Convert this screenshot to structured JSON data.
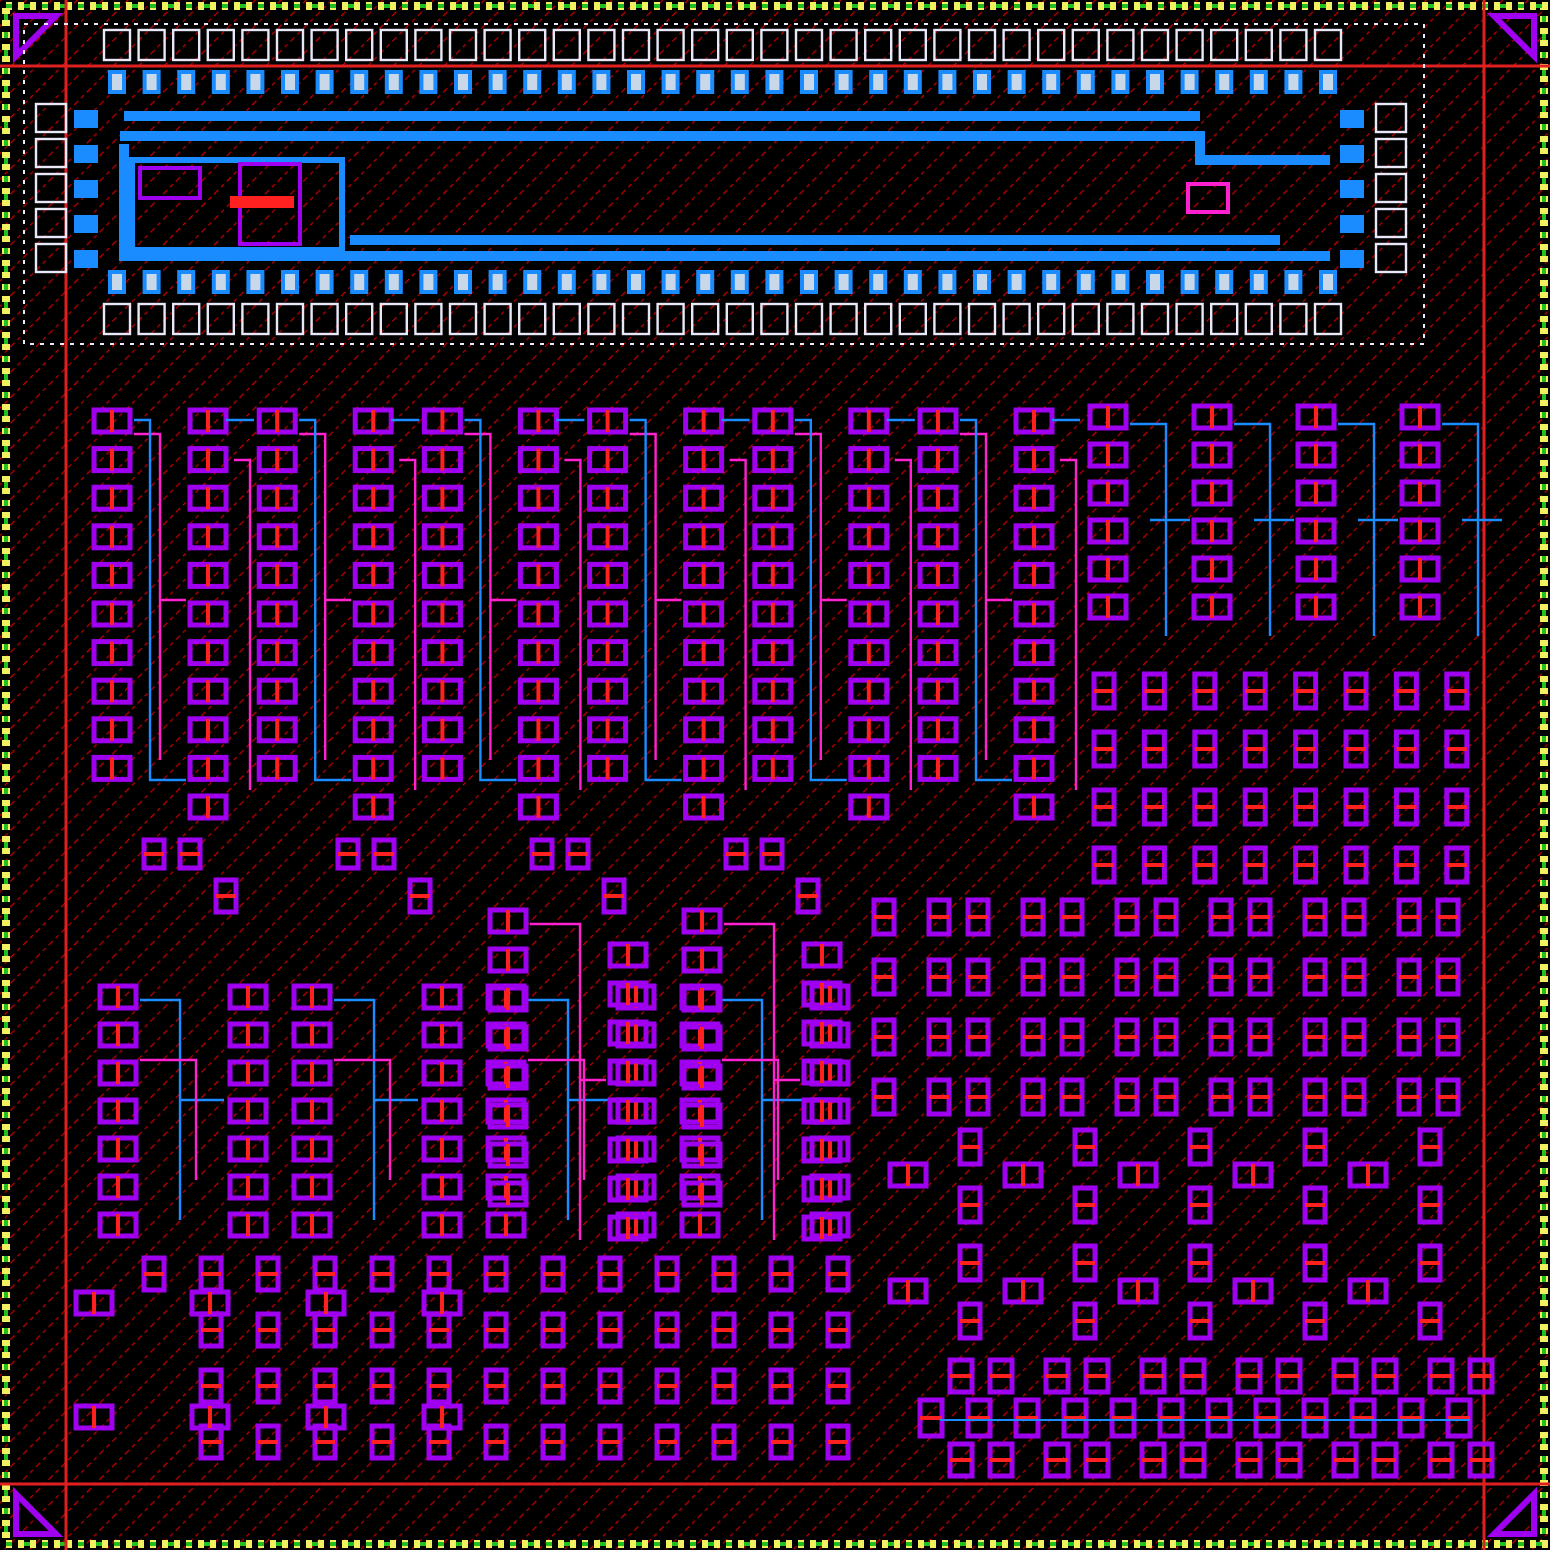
{
  "layout_view": {
    "kind": "chip-layout"
  }
}
